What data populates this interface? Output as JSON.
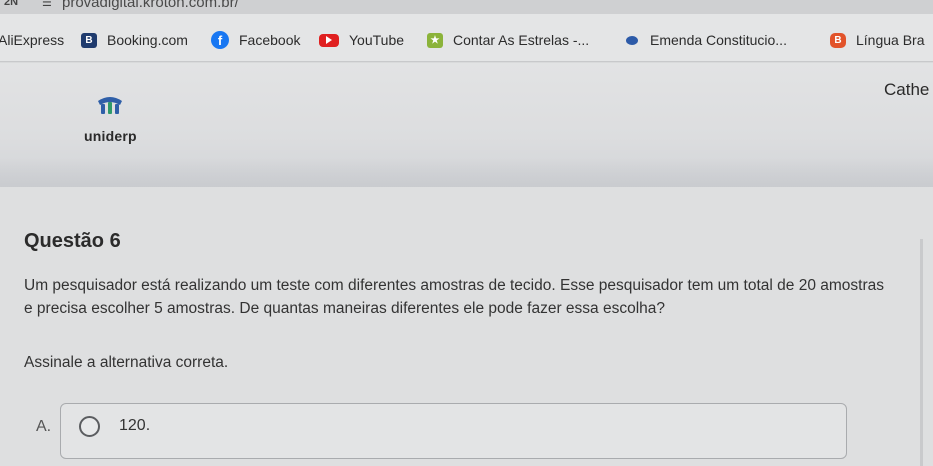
{
  "browser": {
    "tab_number": "2N",
    "url": "provadigital.kroton.com.br/"
  },
  "bookmarks": [
    {
      "label": "AliExpress",
      "icon": "aliexpress-icon"
    },
    {
      "label": "Booking.com",
      "icon": "booking-icon",
      "badge": "B"
    },
    {
      "label": "Facebook",
      "icon": "facebook-icon",
      "badge": "f"
    },
    {
      "label": "YouTube",
      "icon": "youtube-icon"
    },
    {
      "label": "Contar As Estrelas -...",
      "icon": "star-icon",
      "badge": "★"
    },
    {
      "label": "Emenda Constitucio...",
      "icon": "bookmark-dot-icon"
    },
    {
      "label": "Língua Bra",
      "icon": "lingua-icon",
      "badge": "B"
    }
  ],
  "header": {
    "logo_text": "uniderp",
    "user_name": "Cathe"
  },
  "question": {
    "title": "Questão 6",
    "text": "Um pesquisador está realizando um teste com diferentes amostras de tecido. Esse pesquisador tem um total de 20 amostras e precisa escolher 5 amostras. De quantas maneiras diferentes ele pode fazer essa escolha?",
    "instruction": "Assinale a alternativa correta.",
    "alternatives": [
      {
        "letter": "A.",
        "text": "120."
      }
    ]
  },
  "colors": {
    "logo_blue": "#2f5fa8",
    "logo_green": "#2f9a6a"
  }
}
